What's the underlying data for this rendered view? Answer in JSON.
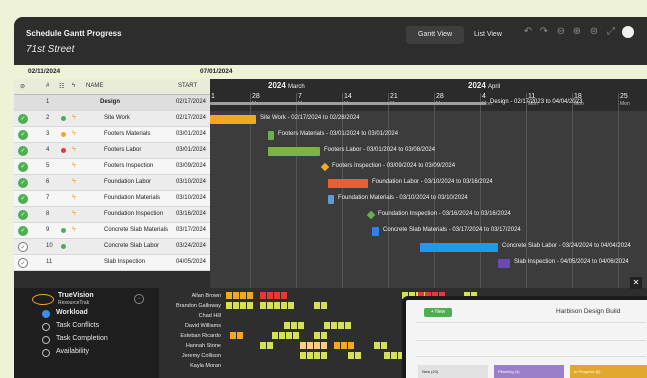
{
  "header": {
    "title": "Schedule Gantt Progress",
    "project": "71st Street",
    "view_tabs": [
      "Gantt View",
      "List View"
    ]
  },
  "date_range": {
    "left": "02/11/2024",
    "right": "07/01/2024"
  },
  "grid_headers": {
    "hash": "#",
    "name": "NAME",
    "start": "START"
  },
  "tasks": [
    {
      "num": "1",
      "name": "Design",
      "start": "02/17/2024",
      "group": true
    },
    {
      "num": "2",
      "name": "Site Work",
      "start": "02/17/2024"
    },
    {
      "num": "3",
      "name": "Footers Materials",
      "start": "03/01/2024"
    },
    {
      "num": "4",
      "name": "Footers Labor",
      "start": "03/01/2024"
    },
    {
      "num": "5",
      "name": "Footers Inspection",
      "start": "03/09/2024"
    },
    {
      "num": "6",
      "name": "Foundation Labor",
      "start": "03/10/2024"
    },
    {
      "num": "7",
      "name": "Foundation Materials",
      "start": "03/10/2024"
    },
    {
      "num": "8",
      "name": "Foundation Inspection",
      "start": "03/16/2024"
    },
    {
      "num": "9",
      "name": "Concrete Slab Materials",
      "start": "03/17/2024"
    },
    {
      "num": "10",
      "name": "Concrete Slab Labor",
      "start": "03/24/2024"
    },
    {
      "num": "11",
      "name": "Slab Inspection",
      "start": "04/05/2024"
    }
  ],
  "timeline": {
    "months": [
      {
        "year": "2024",
        "month": "March"
      },
      {
        "year": "2024",
        "month": "April"
      }
    ],
    "days": [
      {
        "day": "28",
        "name": "Mon"
      },
      {
        "day": "7",
        "name": "Mon"
      },
      {
        "day": "14",
        "name": "Mon"
      },
      {
        "day": "21",
        "name": "Mon"
      },
      {
        "day": "28",
        "name": "Mon"
      },
      {
        "day": "4",
        "name": "Mon"
      },
      {
        "day": "11",
        "name": "Mon"
      },
      {
        "day": "18",
        "name": "Mon"
      },
      {
        "day": "25",
        "name": "Mon"
      }
    ],
    "first_partial": {
      "day": "1",
      "name": "on"
    }
  },
  "bars": [
    {
      "label": "Design - 02/17/2023 to 04/04/2023",
      "color": "#9e9e9e"
    },
    {
      "label": "Site Work - 02/17/2024 to 02/28/2024",
      "color": "#f5a623"
    },
    {
      "label": "Footers Materials - 03/01/2024 to 03/01/2024",
      "color": "#6ab04c"
    },
    {
      "label": "Footers Labor - 03/01/2024 to 03/08/2024",
      "color": "#7cb342"
    },
    {
      "label": "Footers Inspection - 03/09/2024 to 03/09/2024",
      "color": "#f5a623"
    },
    {
      "label": "Foundation Labor - 03/10/2024 to 03/16/2024",
      "color": "#e8612c"
    },
    {
      "label": "Foundation Materials - 03/10/2024 to 03/10/2024",
      "color": "#5b9bd5"
    },
    {
      "label": "Foundation Inspection - 03/16/2024 to 03/16/2024",
      "color": "#6ab04c"
    },
    {
      "label": "Concrete Slab Materials - 03/17/2024 to 03/17/2024",
      "color": "#2f80ed"
    },
    {
      "label": "Concrete Slab Labor - 03/24/2024 to 04/04/2024",
      "color": "#1e9be8"
    },
    {
      "label": "Slab Inspection - 04/05/2024 to 04/06/2024",
      "color": "#6c4ab6"
    }
  ],
  "panel": {
    "brand": "TrueVision",
    "sub": "ResourceTrak",
    "items": [
      "Workload",
      "Task Conflicts",
      "Task Completion",
      "Availability"
    ],
    "selected": "Workload"
  },
  "resources": [
    "Allan Brown",
    "Brandon Galloway",
    "Chad Hill",
    "David Williams",
    "Esteban Ricardo",
    "Hannah Stone",
    "Jeremy Collison",
    "Kayla Moran"
  ],
  "popup": {
    "new_label": "+ New",
    "title": "Harbison Design Build",
    "columns": [
      "New (10)",
      "Planning (4)",
      "In Progress (6)"
    ]
  },
  "colors": {
    "accent_orange": "#f5a623",
    "accent_green": "#4caf50",
    "accent_blue": "#3a8ee6"
  }
}
